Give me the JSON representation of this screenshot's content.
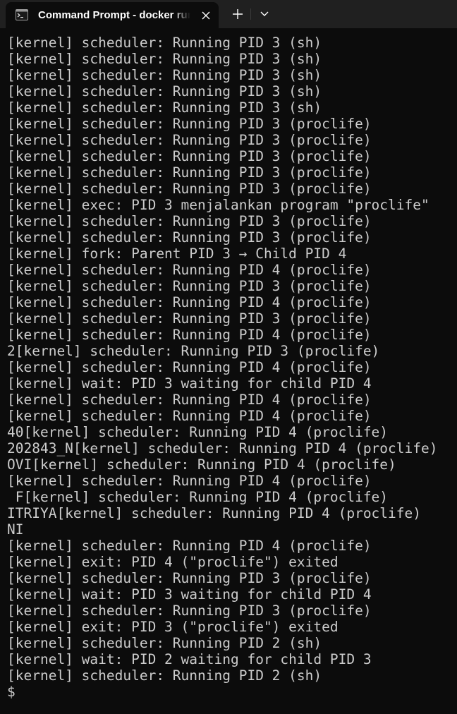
{
  "window": {
    "tab_title": "Command Prompt - docker  run",
    "icons": {
      "tab_icon": "terminal-icon",
      "close": "close-icon",
      "new_tab": "plus-icon",
      "dropdown": "chevron-down-icon"
    }
  },
  "terminal": {
    "lines": [
      "[kernel] scheduler: Running PID 3 (sh)",
      "[kernel] scheduler: Running PID 3 (sh)",
      "[kernel] scheduler: Running PID 3 (sh)",
      "[kernel] scheduler: Running PID 3 (sh)",
      "[kernel] scheduler: Running PID 3 (sh)",
      "[kernel] scheduler: Running PID 3 (proclife)",
      "[kernel] scheduler: Running PID 3 (proclife)",
      "[kernel] scheduler: Running PID 3 (proclife)",
      "[kernel] scheduler: Running PID 3 (proclife)",
      "[kernel] scheduler: Running PID 3 (proclife)",
      "[kernel] exec: PID 3 menjalankan program \"proclife\"",
      "[kernel] scheduler: Running PID 3 (proclife)",
      "[kernel] scheduler: Running PID 3 (proclife)",
      "[kernel] fork: Parent PID 3 → Child PID 4",
      "[kernel] scheduler: Running PID 4 (proclife)",
      "[kernel] scheduler: Running PID 3 (proclife)",
      "[kernel] scheduler: Running PID 4 (proclife)",
      "[kernel] scheduler: Running PID 3 (proclife)",
      "[kernel] scheduler: Running PID 4 (proclife)",
      "2[kernel] scheduler: Running PID 3 (proclife)",
      "[kernel] scheduler: Running PID 4 (proclife)",
      "[kernel] wait: PID 3 waiting for child PID 4",
      "[kernel] scheduler: Running PID 4 (proclife)",
      "[kernel] scheduler: Running PID 4 (proclife)",
      "40[kernel] scheduler: Running PID 4 (proclife)",
      "202843_N[kernel] scheduler: Running PID 4 (proclife)",
      "OVI[kernel] scheduler: Running PID 4 (proclife)",
      "[kernel] scheduler: Running PID 4 (proclife)",
      " F[kernel] scheduler: Running PID 4 (proclife)",
      "ITRIYA[kernel] scheduler: Running PID 4 (proclife)",
      "NI",
      "[kernel] scheduler: Running PID 4 (proclife)",
      "[kernel] exit: PID 4 (\"proclife\") exited",
      "[kernel] scheduler: Running PID 3 (proclife)",
      "[kernel] wait: PID 3 waiting for child PID 4",
      "[kernel] scheduler: Running PID 3 (proclife)",
      "[kernel] exit: PID 3 (\"proclife\") exited",
      "[kernel] scheduler: Running PID 2 (sh)",
      "[kernel] wait: PID 2 waiting for child PID 3",
      "[kernel] scheduler: Running PID 2 (sh)"
    ],
    "prompt": "$"
  },
  "colors": {
    "background": "#0c0c0c",
    "titlebar": "#202020",
    "text": "#cccccc",
    "title_text": "#ffffff"
  }
}
